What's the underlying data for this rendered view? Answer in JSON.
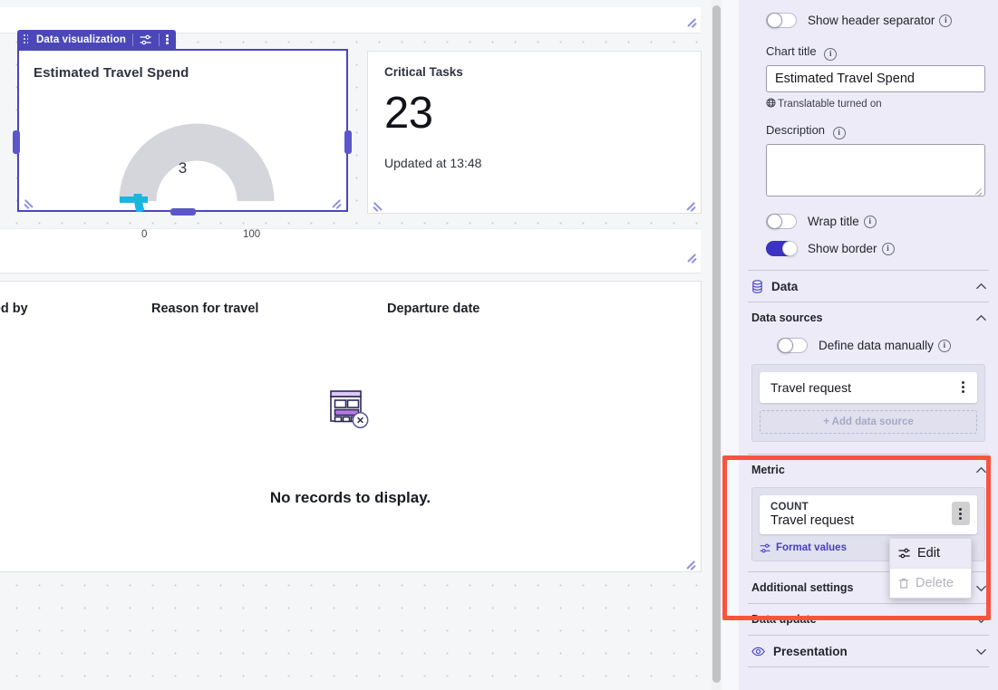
{
  "canvas": {
    "widget_toolbar": {
      "label": "Data visualization",
      "drag_handle_icon": "drag-dots-icon",
      "settings_icon": "sliders-icon",
      "more_icon": "kebab-menu-icon"
    },
    "chart_card": {
      "title": "Estimated Travel Spend",
      "gauge": {
        "value": "3",
        "min_label": "0",
        "max_label": "100"
      }
    },
    "kpi_card": {
      "title": "Critical Tasks",
      "value": "23",
      "subtitle": "Updated at 13:48"
    },
    "table_card": {
      "columns": [
        "pened by",
        "Reason for travel",
        "Departure date"
      ],
      "empty_message": "No records to display.",
      "empty_icon": "no-records-icon"
    }
  },
  "panel": {
    "show_header_separator": {
      "label": "Show header separator",
      "state": "off",
      "info_icon": "info-icon"
    },
    "chart_title": {
      "label": "Chart title",
      "value": "Estimated Travel Spend",
      "info_icon": "info-icon",
      "translatable_note": "Translatable turned on",
      "translatable_icon": "globe-icon"
    },
    "description": {
      "label": "Description",
      "value": "",
      "info_icon": "info-icon"
    },
    "wrap_title": {
      "label": "Wrap title",
      "state": "off",
      "info_icon": "info-icon"
    },
    "show_border": {
      "label": "Show border",
      "state": "on",
      "info_icon": "info-icon"
    },
    "sections": {
      "data": {
        "label": "Data",
        "icon": "database-icon",
        "expanded": true
      },
      "data_sources": {
        "label": "Data sources",
        "expanded": true
      },
      "metric": {
        "label": "Metric",
        "expanded": true
      },
      "additional_settings": {
        "label": "Additional settings",
        "expanded": false
      },
      "data_update": {
        "label": "Data update",
        "expanded": false
      },
      "presentation": {
        "label": "Presentation",
        "icon": "eye-icon",
        "expanded": false
      }
    },
    "define_data_manually": {
      "label": "Define data manually",
      "state": "off",
      "info_icon": "info-icon"
    },
    "data_source_card": {
      "name": "Travel request",
      "more_icon": "kebab-menu-icon"
    },
    "add_data_source": {
      "label": "+ Add data source"
    },
    "metric_card": {
      "aggregation": "COUNT",
      "name": "Travel request",
      "more_icon": "kebab-menu-icon",
      "format_values_label": "Format values",
      "format_values_icon": "sliders-icon"
    },
    "context_menu": {
      "items": [
        {
          "label": "Edit",
          "icon": "sliders-icon",
          "disabled": false
        },
        {
          "label": "Delete",
          "icon": "trash-icon",
          "disabled": true
        }
      ]
    },
    "highlight": {
      "color": "#f9533f"
    }
  },
  "colors": {
    "accent_purple": "#4b47b8",
    "toggle_on": "#3c34c0",
    "panel_bg": "#ecebf7",
    "gauge_track": "#d5d6dc",
    "gauge_fill": "#19b6e0",
    "highlight_red": "#f9533f"
  }
}
